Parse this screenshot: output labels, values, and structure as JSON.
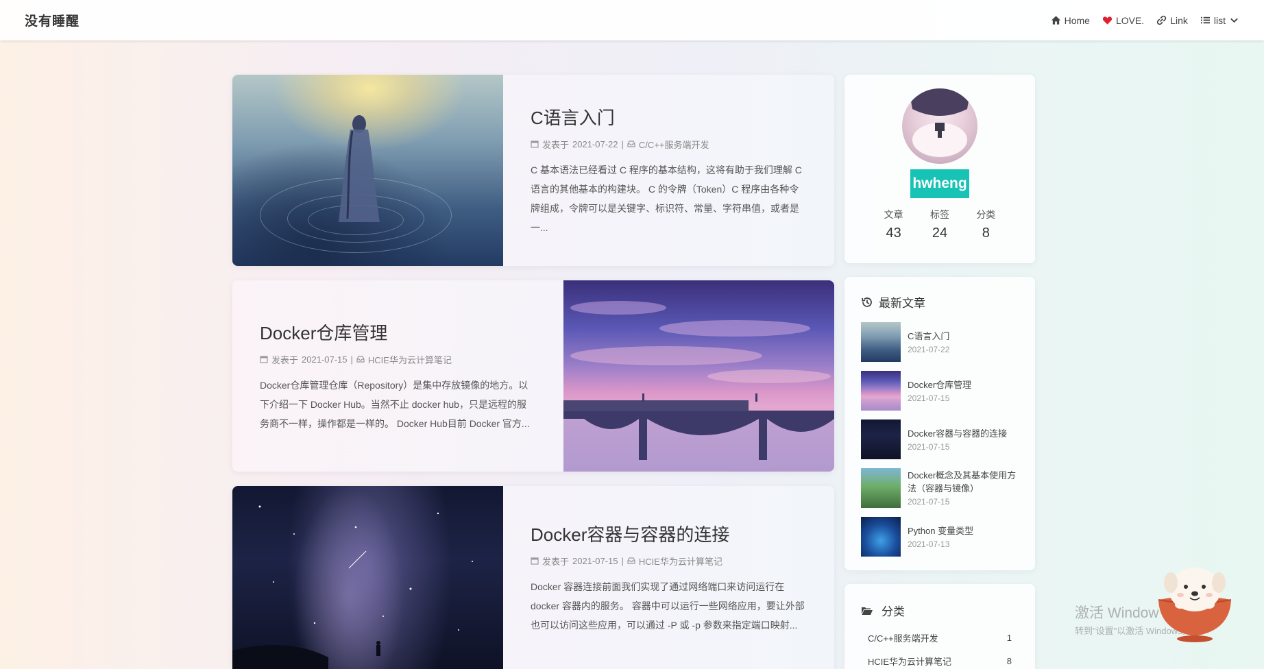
{
  "nav": {
    "brand": "没有睡醒",
    "links": [
      {
        "label": "Home",
        "icon": "home-icon"
      },
      {
        "label": "LOVE.",
        "icon": "heart-icon"
      },
      {
        "label": "Link",
        "icon": "link-icon"
      },
      {
        "label": "list",
        "icon": "list-icon"
      }
    ]
  },
  "posts": [
    {
      "title": "C语言入门",
      "meta_prefix": "发表于",
      "date": "2021-07-22",
      "separator": "|",
      "category": "C/C++服务端开发",
      "excerpt": "C 基本语法已经看过 C 程序的基本结构，这将有助于我们理解 C 语言的其他基本的构建块。 C 的令牌（Token）C 程序由各种令牌组成，令牌可以是关键字、标识符、常量、字符串值，或者是一..."
    },
    {
      "title": "Docker仓库管理",
      "meta_prefix": "发表于",
      "date": "2021-07-15",
      "separator": "|",
      "category": "HCIE华为云计算笔记",
      "excerpt": "Docker仓库管理仓库（Repository）是集中存放镜像的地方。以下介绍一下 Docker Hub。当然不止 docker hub，只是远程的服务商不一样，操作都是一样的。 Docker Hub目前 Docker 官方..."
    },
    {
      "title": "Docker容器与容器的连接",
      "meta_prefix": "发表于",
      "date": "2021-07-15",
      "separator": "|",
      "category": "HCIE华为云计算笔记",
      "excerpt": "Docker 容器连接前面我们实现了通过网络端口来访问运行在 docker 容器内的服务。 容器中可以运行一些网络应用，要让外部也可以访问这些应用，可以通过 -P 或 -p 参数来指定端口映射..."
    }
  ],
  "profile": {
    "username": "hwheng",
    "stats": [
      {
        "label": "文章",
        "value": "43"
      },
      {
        "label": "标签",
        "value": "24"
      },
      {
        "label": "分类",
        "value": "8"
      }
    ]
  },
  "recent": {
    "title": "最新文章",
    "items": [
      {
        "title": "C语言入门",
        "date": "2021-07-22"
      },
      {
        "title": "Docker仓库管理",
        "date": "2021-07-15"
      },
      {
        "title": "Docker容器与容器的连接",
        "date": "2021-07-15"
      },
      {
        "title": "Docker概念及其基本使用方法（容器与镜像）",
        "date": "2021-07-15"
      },
      {
        "title": "Python 变量类型",
        "date": "2021-07-13"
      }
    ]
  },
  "categories": {
    "title": "分类",
    "items": [
      {
        "name": "C/C++服务端开发",
        "count": "1"
      },
      {
        "name": "HCIE华为云计算笔记",
        "count": "8"
      }
    ]
  },
  "watermark": {
    "line1": "激活 Window",
    "line2": "转到\"设置\"以激活 Windows。"
  },
  "colors": {
    "accent": "#17c3b4",
    "heart": "#e0202e"
  }
}
